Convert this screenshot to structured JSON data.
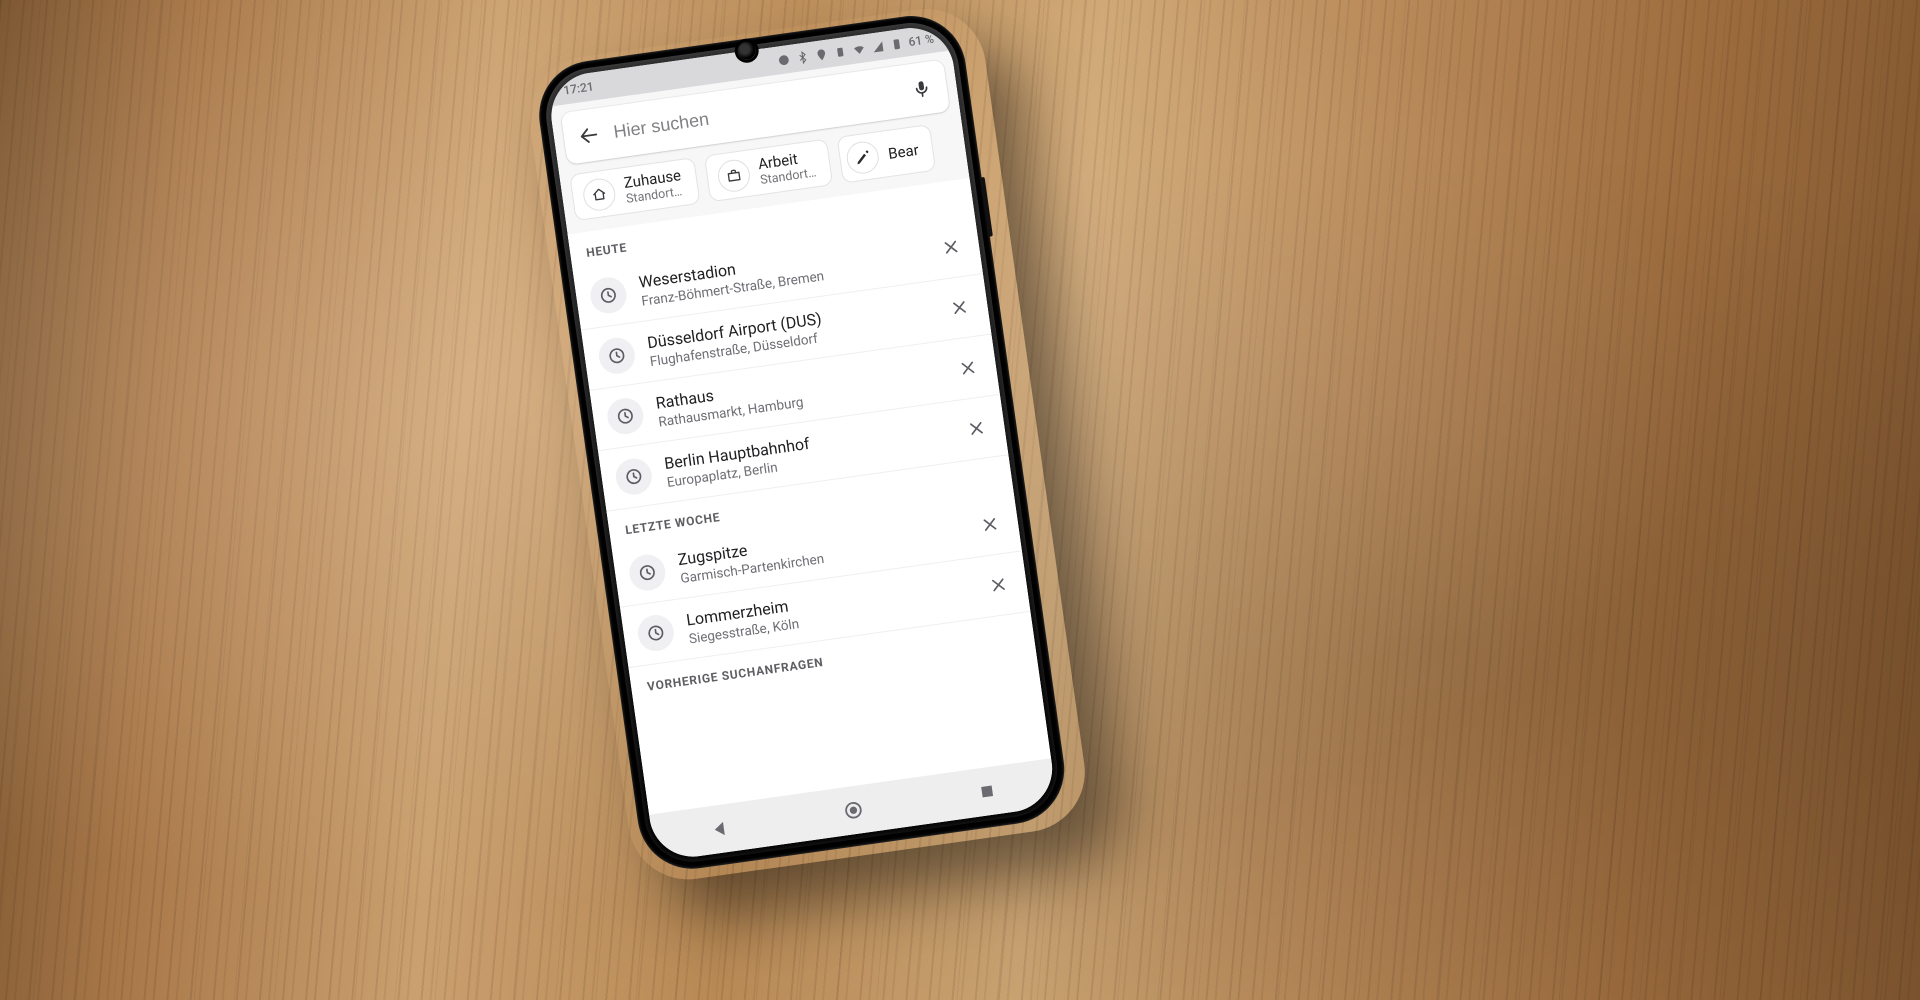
{
  "status": {
    "time": "17:21",
    "battery": "61 %"
  },
  "search": {
    "placeholder": "Hier suchen"
  },
  "chips": {
    "home": {
      "title": "Zuhause",
      "subtitle": "Standort…"
    },
    "work": {
      "title": "Arbeit",
      "subtitle": "Standort…"
    },
    "edit_label": "Bear"
  },
  "sections": {
    "today_label": "Heute",
    "lastweek_label": "Letzte Woche",
    "previous_label": "Vorherige Suchanfragen",
    "today": [
      {
        "title": "Weserstadion",
        "subtitle": "Franz-Böhmert-Straße, Bremen"
      },
      {
        "title": "Düsseldorf Airport (DUS)",
        "subtitle": "Flughafenstraße, Düsseldorf"
      },
      {
        "title": "Rathaus",
        "subtitle": "Rathausmarkt, Hamburg"
      },
      {
        "title": "Berlin Hauptbahnhof",
        "subtitle": "Europaplatz, Berlin"
      }
    ],
    "lastweek": [
      {
        "title": "Zugspitze",
        "subtitle": "Garmisch-Partenkirchen"
      },
      {
        "title": "Lommerzheim",
        "subtitle": "Siegesstraße, Köln"
      }
    ]
  }
}
